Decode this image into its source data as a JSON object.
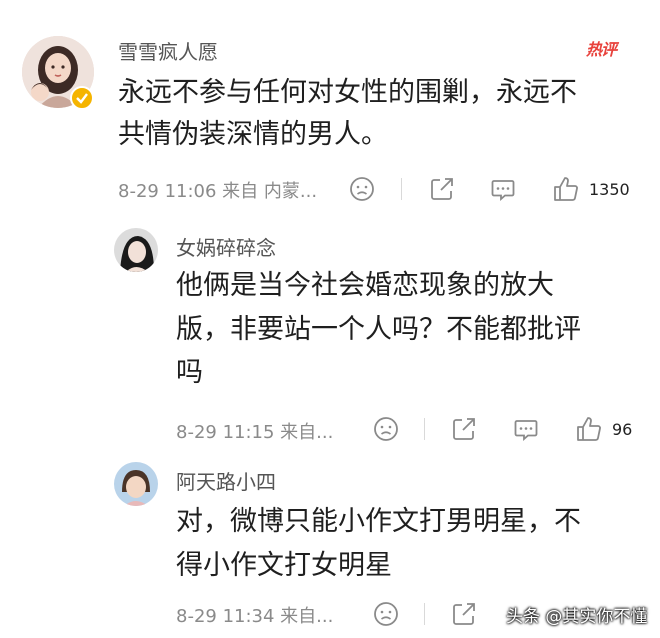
{
  "hot_badge": "热评",
  "watermark": "头条 @其实你不懂",
  "comments": [
    {
      "username": "雪雪疯人愿",
      "text_lines": [
        "永远不参与任何对女性的围剿，永远不",
        "共情伪装深情的男人。"
      ],
      "meta": "8-29 11:06  来自 内蒙...",
      "likes": "1350"
    },
    {
      "username": "女娲碎碎念",
      "text_lines": [
        "他俩是当今社会婚恋现象的放大",
        "版，非要站一个人吗？不能都批评",
        "吗"
      ],
      "meta": "8-29 11:15  来自...",
      "likes": "96"
    },
    {
      "username": "阿天路小四",
      "text_lines": [
        "对，微博只能小作文打男明星，不",
        "得小作文打女明星"
      ],
      "meta": "8-29 11:34  来自...",
      "likes": ""
    }
  ],
  "icons": [
    "verified-badge-icon",
    "dislike-face-icon",
    "share-icon",
    "comment-icon",
    "like-thumb-icon"
  ],
  "colors": {
    "hot_badge": "#e8423c",
    "verified": "#f5b400",
    "meta_text": "#8a8a8a"
  }
}
